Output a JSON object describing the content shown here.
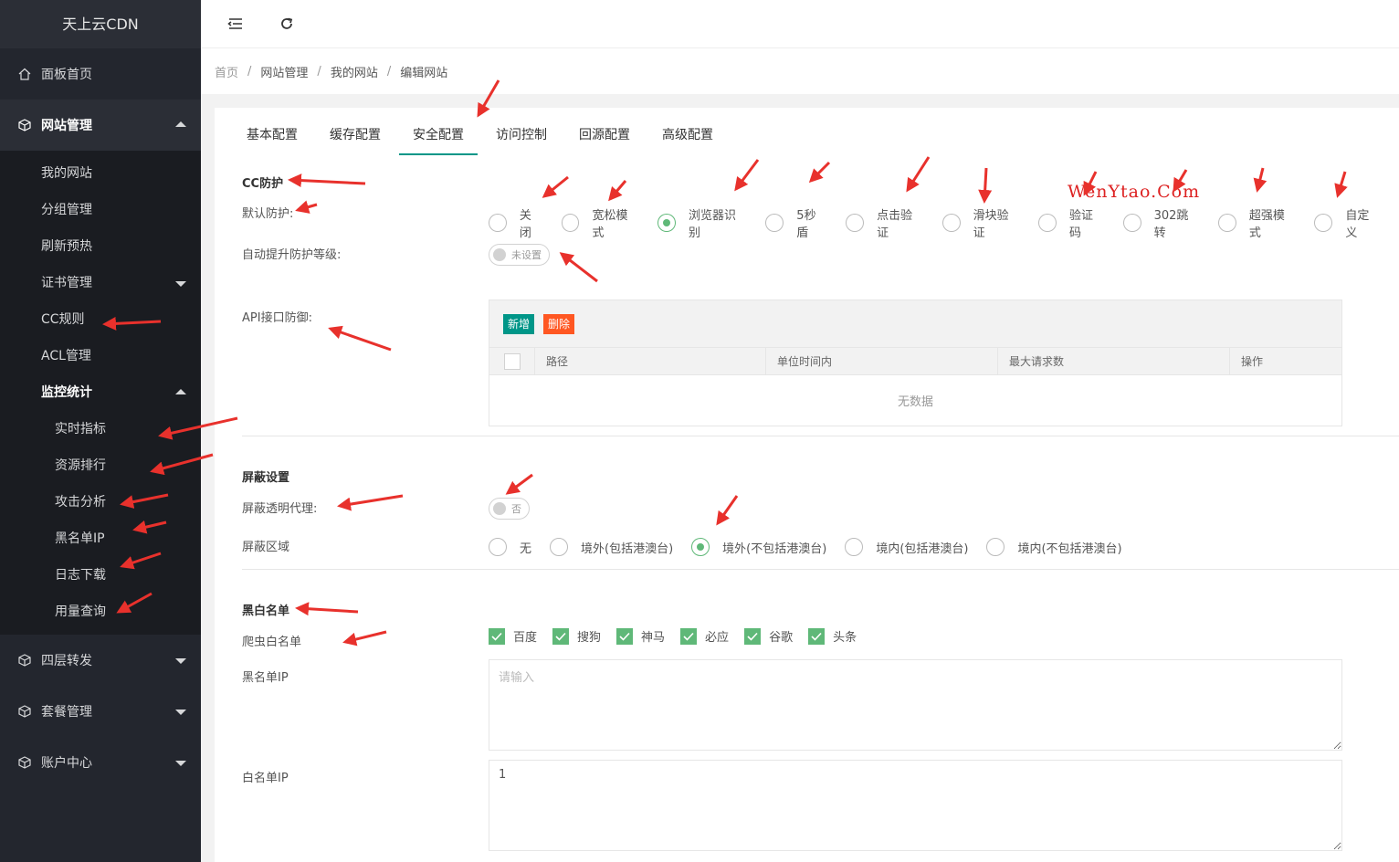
{
  "colors": {
    "sidebar_bg": "#23262e",
    "accent": "#009688",
    "checked": "#5fb878",
    "danger": "#ff5722",
    "annotation": "#e8312c"
  },
  "brand": "天上云CDN",
  "sidebar": {
    "home": "面板首页",
    "site_mgmt": "网站管理",
    "site_sub": [
      "我的网站",
      "分组管理",
      "刷新预热",
      "证书管理",
      "CC规则",
      "ACL管理",
      "监控统计"
    ],
    "monitor_sub": [
      "实时指标",
      "资源排行",
      "攻击分析",
      "黑名单IP",
      "日志下载",
      "用量查询"
    ],
    "l4": "四层转发",
    "package": "套餐管理",
    "account": "账户中心"
  },
  "topbar": {
    "icons": [
      "menu-fold-icon",
      "refresh-icon"
    ]
  },
  "breadcrumb": [
    "首页",
    "网站管理",
    "我的网站",
    "编辑网站"
  ],
  "tabs": [
    "基本配置",
    "缓存配置",
    "安全配置",
    "访问控制",
    "回源配置",
    "高级配置"
  ],
  "active_tab": "安全配置",
  "cc": {
    "title": "CC防护",
    "default_label": "默认防护:",
    "modes": [
      "关闭",
      "宽松模式",
      "浏览器识别",
      "5秒盾",
      "点击验证",
      "滑块验证",
      "验证码",
      "302跳转",
      "超强模式",
      "自定义"
    ],
    "selected_mode": "浏览器识别",
    "auto_label": "自动提升防护等级:",
    "auto_switch": "未设置",
    "api_label": "API接口防御:",
    "btn_add": "新增",
    "btn_delete": "删除",
    "columns": [
      "路径",
      "单位时间内",
      "最大请求数",
      "操作"
    ],
    "empty_text": "无数据"
  },
  "shield": {
    "title": "屏蔽设置",
    "proxy_label": "屏蔽透明代理:",
    "proxy_switch": "否",
    "region_label": "屏蔽区域",
    "regions": [
      "无",
      "境外(包括港澳台)",
      "境外(不包括港澳台)",
      "境内(包括港澳台)",
      "境内(不包括港澳台)"
    ],
    "selected_region": "境外(不包括港澳台)"
  },
  "bw": {
    "title": "黑白名单",
    "crawler_label": "爬虫白名单",
    "crawlers": [
      "百度",
      "搜狗",
      "神马",
      "必应",
      "谷歌",
      "头条"
    ],
    "black_label": "黑名单IP",
    "black_placeholder": "请输入",
    "white_label": "白名单IP",
    "white_value": "1"
  },
  "watermark": "WenYtao.Com"
}
